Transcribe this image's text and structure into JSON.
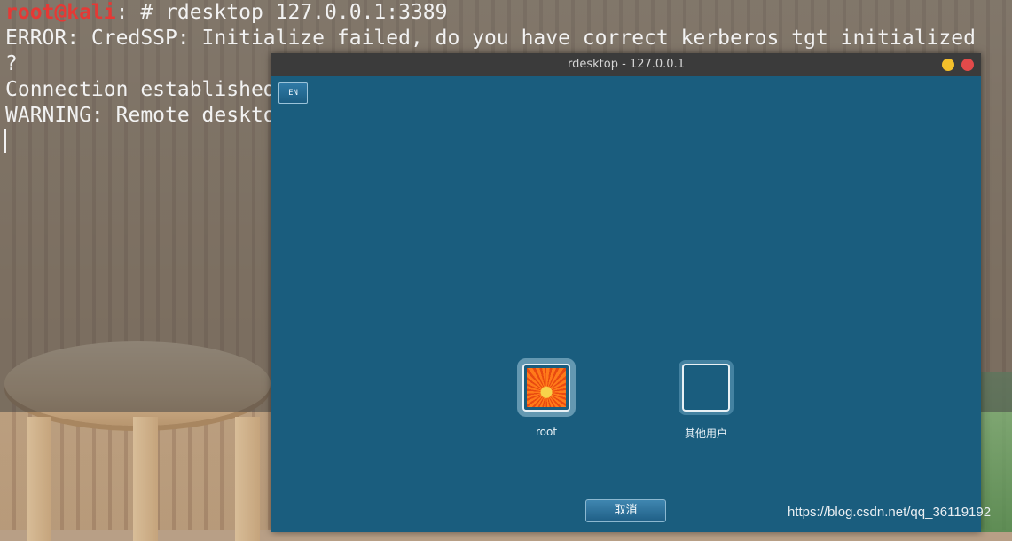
{
  "terminal": {
    "prompt_user": "root@kali",
    "prompt_rest": ": # rdesktop 127.0.0.1:3389",
    "line2": "ERROR: CredSSP: Initialize failed, do you have correct kerberos tgt initialized",
    "line3": "?",
    "line4": "Connection established",
    "line5": "WARNING: Remote deskto"
  },
  "window": {
    "title": "rdesktop - 127.0.0.1"
  },
  "login": {
    "lang_label": "EN",
    "users": [
      {
        "label": "root",
        "icon": "flower-avatar-icon"
      },
      {
        "label": "其他用户",
        "icon": "blank-avatar-icon"
      }
    ],
    "cancel_label": "取消"
  },
  "watermark": "https://blog.csdn.net/qq_36119192",
  "colors": {
    "desktop_bg": "#1a5d7e",
    "prompt_user": "#e53935",
    "minimize": "#f4c02b",
    "close": "#e34a4a"
  }
}
